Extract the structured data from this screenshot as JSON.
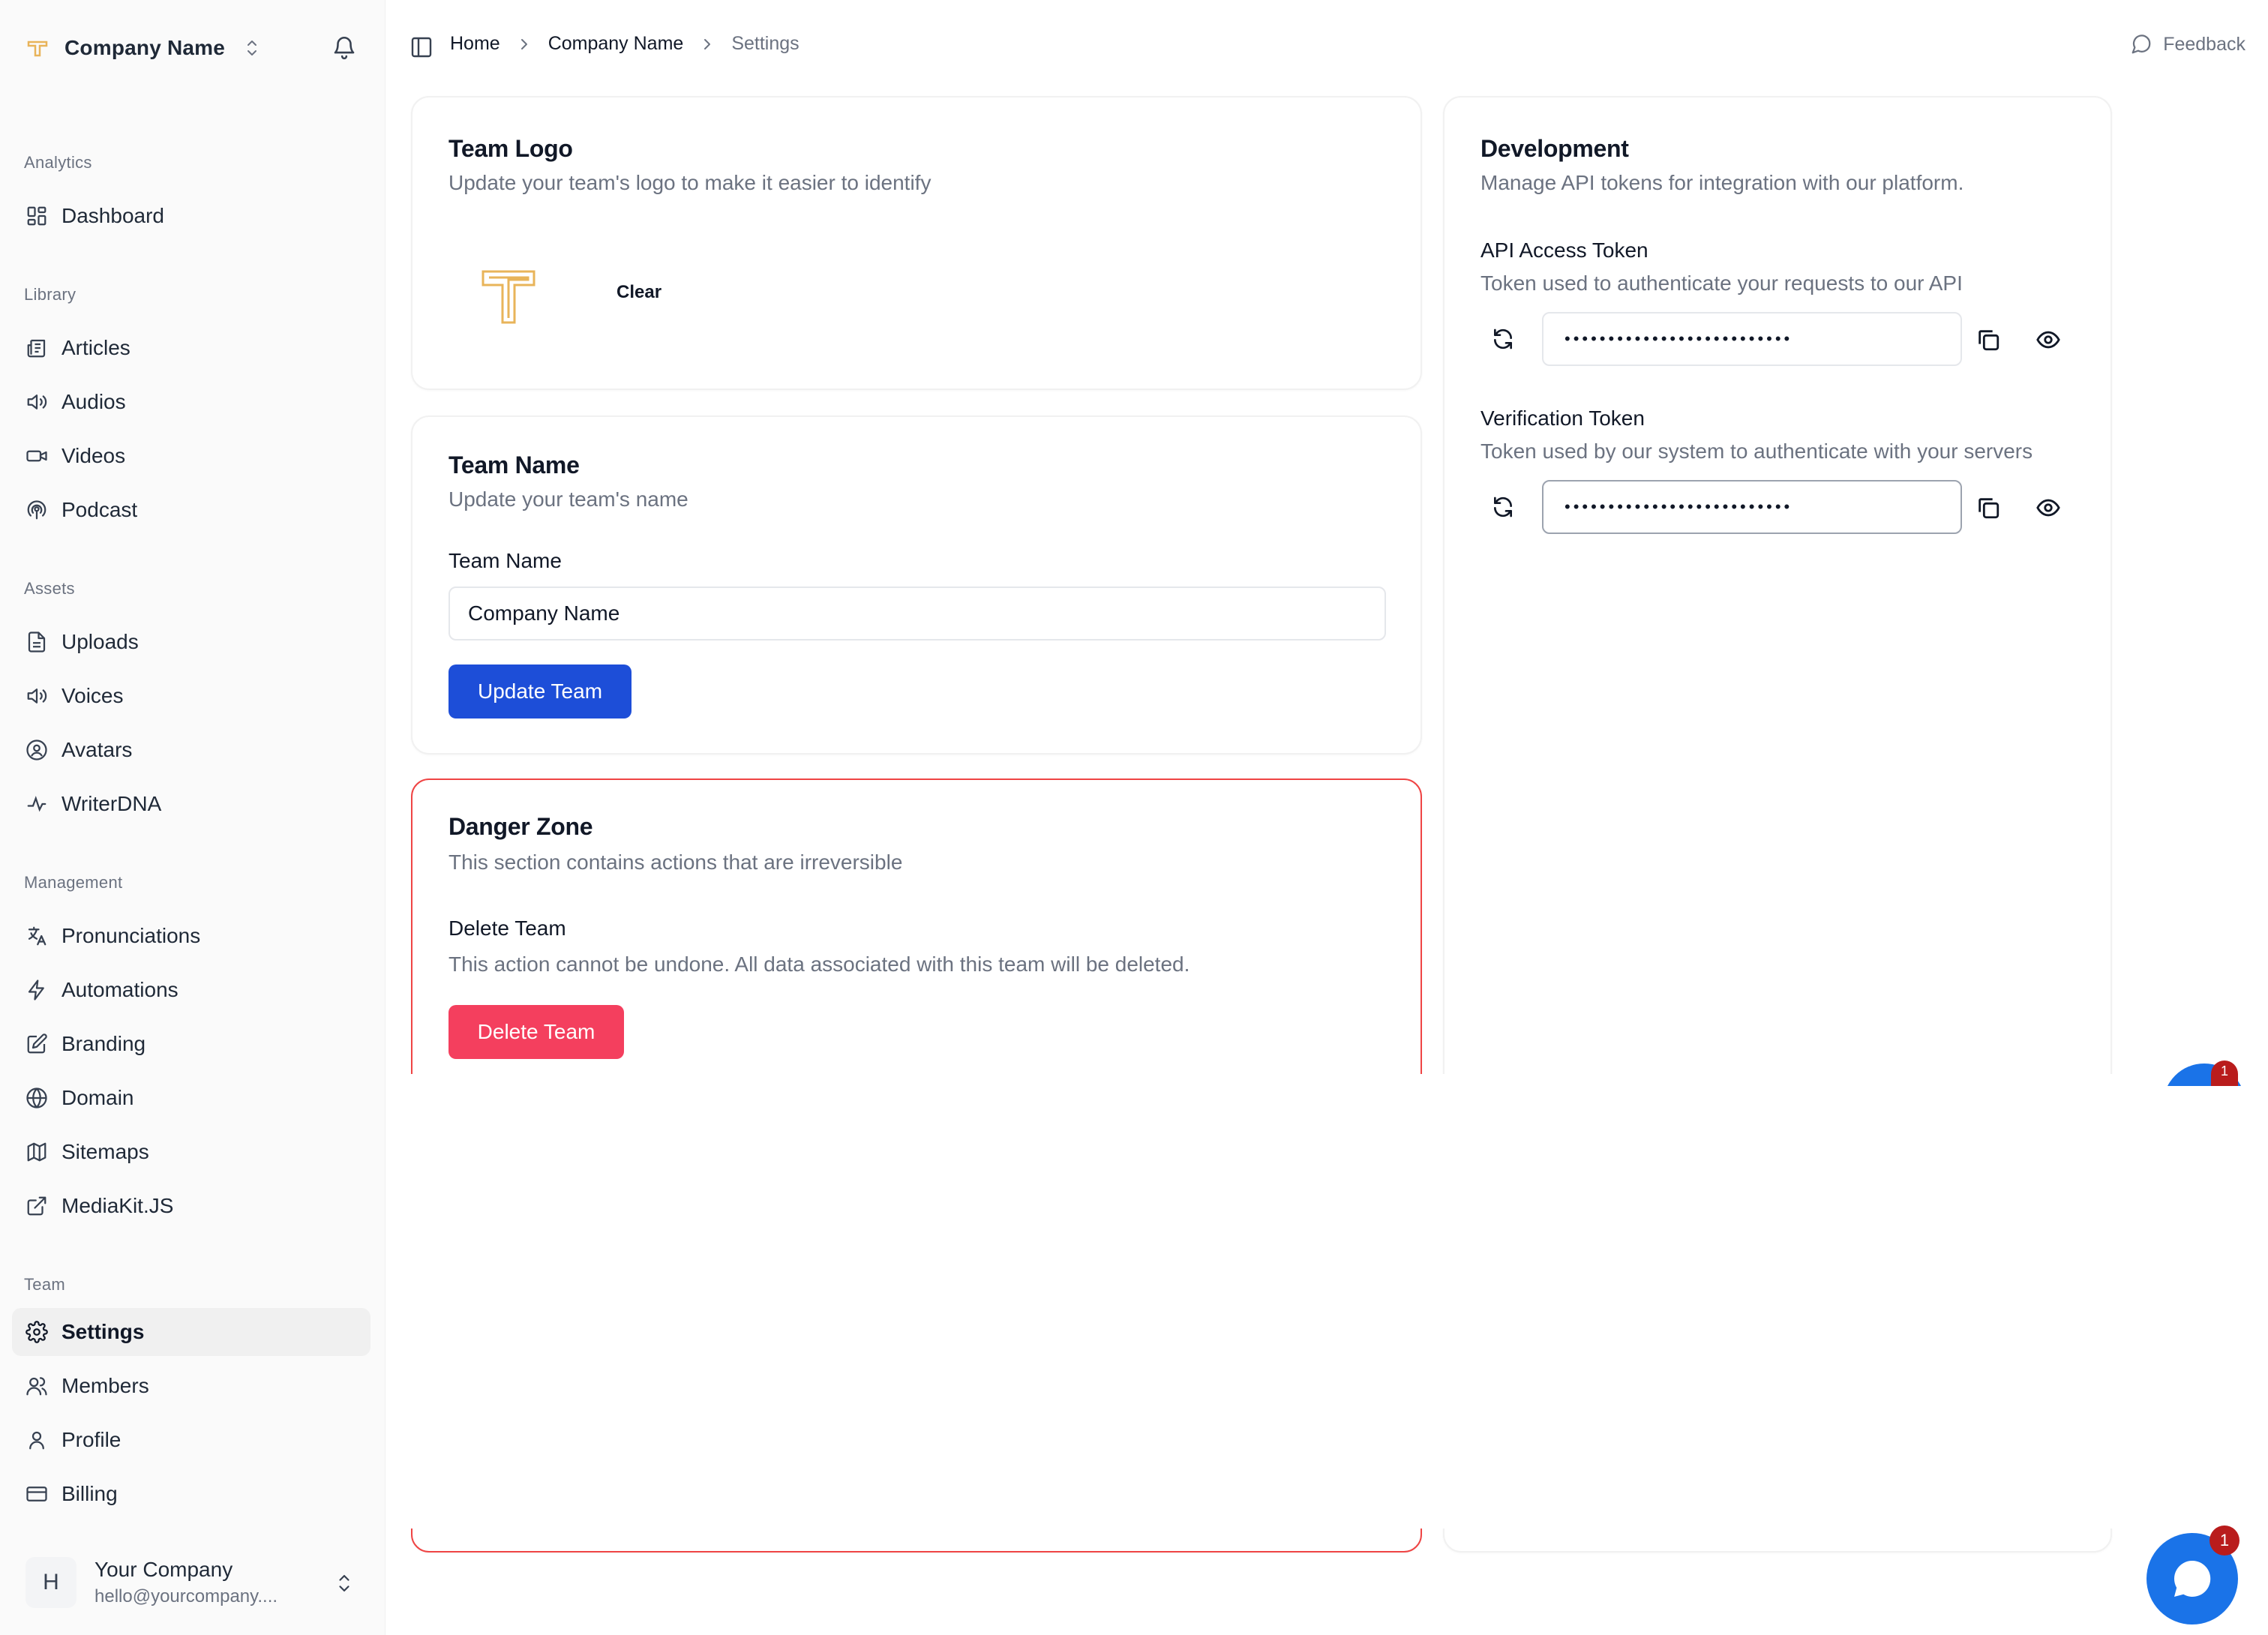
{
  "sidebar": {
    "team_name": "Company Name",
    "groups": {
      "analytics": "Analytics",
      "library": "Library",
      "assets": "Assets",
      "management": "Management",
      "team": "Team"
    },
    "items": {
      "dashboard": "Dashboard",
      "articles": "Articles",
      "audios": "Audios",
      "videos": "Videos",
      "podcast": "Podcast",
      "uploads": "Uploads",
      "voices": "Voices",
      "avatars": "Avatars",
      "writerdna": "WriterDNA",
      "pronunciations": "Pronunciations",
      "automations": "Automations",
      "branding": "Branding",
      "domain": "Domain",
      "sitemaps": "Sitemaps",
      "mediakit": "MediaKit.JS",
      "settings": "Settings",
      "members": "Members",
      "profile": "Profile",
      "billing": "Billing"
    },
    "active_item": "settings",
    "user": {
      "initial": "H",
      "name": "Your Company",
      "email": "hello@yourcompany...."
    }
  },
  "header": {
    "breadcrumb": [
      "Home",
      "Company Name",
      "Settings"
    ],
    "feedback_label": "Feedback"
  },
  "team_logo": {
    "title": "Team Logo",
    "subtitle": "Update your team's logo to make it easier to identify",
    "clear_label": "Clear"
  },
  "team_name": {
    "title": "Team Name",
    "subtitle": "Update your team's name",
    "field_label": "Team Name",
    "field_value": "Company Name",
    "submit_label": "Update Team"
  },
  "danger_zone": {
    "title": "Danger Zone",
    "subtitle": "This section contains actions that are irreversible",
    "delete_title": "Delete Team",
    "delete_desc": "This action cannot be undone. All data associated with this team will be deleted.",
    "delete_label": "Delete Team"
  },
  "development": {
    "title": "Development",
    "subtitle": "Manage API tokens for integration with our platform.",
    "api_token": {
      "label": "API Access Token",
      "desc": "Token used to authenticate your requests to our API",
      "masked": "••••••••••••••••••••••••••"
    },
    "verification_token": {
      "label": "Verification Token",
      "desc": "Token used by our system to authenticate with your servers",
      "masked": "••••••••••••••••••••••••••"
    }
  },
  "chat": {
    "badge": "1"
  },
  "colors": {
    "primary": "#1d4ed8",
    "danger": "#f43f5e",
    "danger_border": "#ef4444",
    "logo_gold": "#e8b45a",
    "chat_blue": "#1a73e8"
  }
}
